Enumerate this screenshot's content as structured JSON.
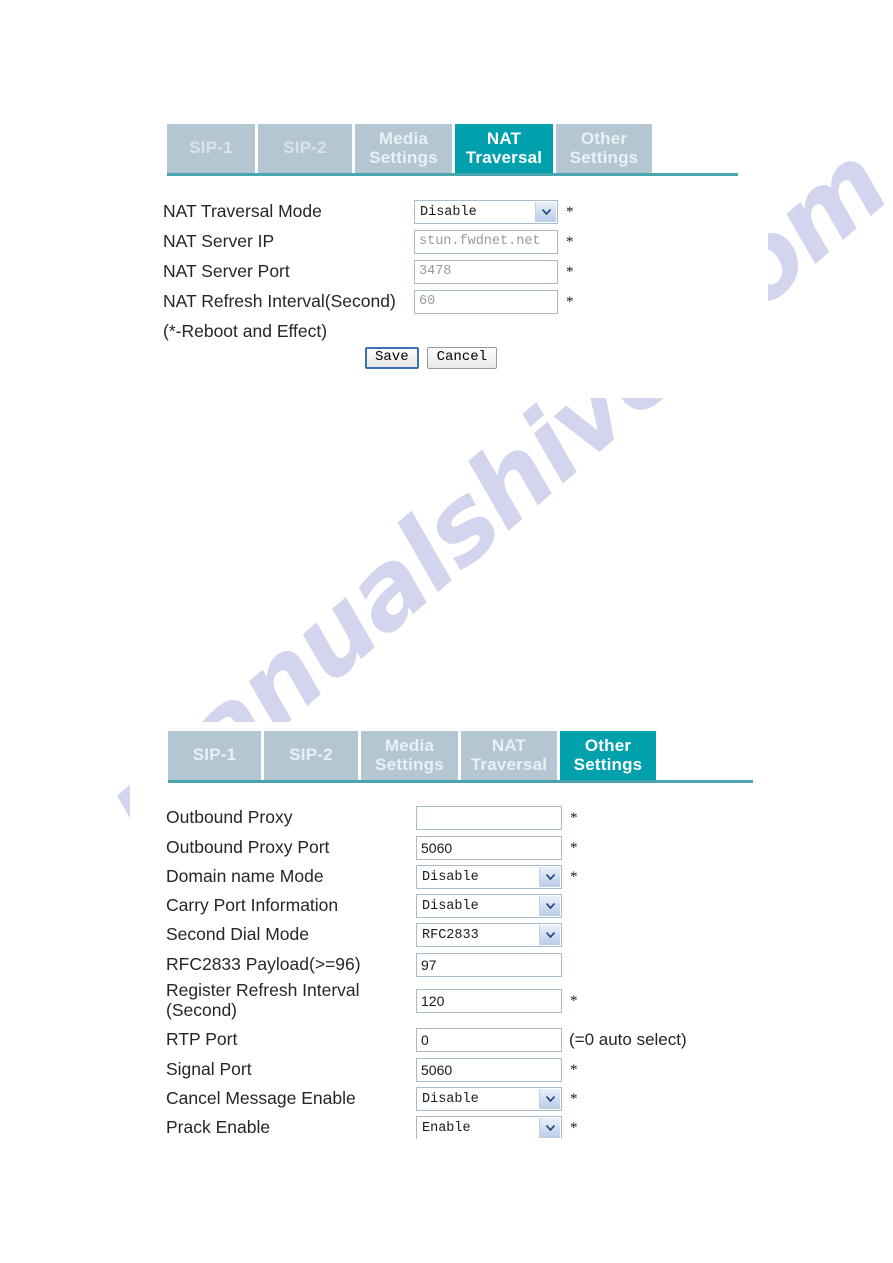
{
  "watermark": {
    "text": "manualshive.com"
  },
  "panels": {
    "nat": {
      "tabs": [
        {
          "name": "sip-1",
          "line1": "SIP-1",
          "line2": ""
        },
        {
          "name": "sip-2",
          "line1": "SIP-2",
          "line2": ""
        },
        {
          "name": "media-settings",
          "line1": "Media",
          "line2": "Settings"
        },
        {
          "name": "nat-traversal",
          "line1": "NAT",
          "line2": "Traversal"
        },
        {
          "name": "other-settings",
          "line1": "Other",
          "line2": "Settings"
        }
      ],
      "active_tab": "NAT Traversal",
      "fields": [
        {
          "label": "NAT Traversal Mode",
          "type": "select",
          "value": "Disable",
          "required": "*",
          "disabled": false
        },
        {
          "label": "NAT Server IP",
          "type": "text",
          "value": "stun.fwdnet.net",
          "required": "*",
          "disabled": true
        },
        {
          "label": "NAT Server Port",
          "type": "text",
          "value": "3478",
          "required": "*",
          "disabled": true
        },
        {
          "label": "NAT Refresh Interval(Second)",
          "type": "text",
          "value": "60",
          "required": "*",
          "disabled": true
        }
      ],
      "note": "(*-Reboot and Effect)",
      "buttons": {
        "save": "Save",
        "cancel": "Cancel"
      }
    },
    "other": {
      "tabs": [
        {
          "name": "sip-1",
          "line1": "SIP-1",
          "line2": ""
        },
        {
          "name": "sip-2",
          "line1": "SIP-2",
          "line2": ""
        },
        {
          "name": "media-settings",
          "line1": "Media",
          "line2": "Settings"
        },
        {
          "name": "nat-traversal",
          "line1": "NAT",
          "line2": "Traversal"
        },
        {
          "name": "other-settings",
          "line1": "Other",
          "line2": "Settings"
        }
      ],
      "active_tab": "Other Settings",
      "fields": [
        {
          "label": "Outbound Proxy",
          "type": "text",
          "value": "",
          "required": "*",
          "hint": ""
        },
        {
          "label": "Outbound Proxy Port",
          "type": "text",
          "value": "5060",
          "required": "*",
          "hint": ""
        },
        {
          "label": "Domain name Mode",
          "type": "select",
          "value": "Disable",
          "required": "*",
          "hint": ""
        },
        {
          "label": "Carry Port Information",
          "type": "select",
          "value": "Disable",
          "required": "",
          "hint": ""
        },
        {
          "label": "Second Dial Mode",
          "type": "select",
          "value": "RFC2833",
          "required": "",
          "hint": ""
        },
        {
          "label": "RFC2833 Payload(>=96)",
          "type": "text",
          "value": "97",
          "required": "",
          "hint": ""
        },
        {
          "label": "Register Refresh Interval\n(Second)",
          "type": "text",
          "value": "120",
          "required": "*",
          "hint": ""
        },
        {
          "label": "RTP Port",
          "type": "text",
          "value": "0",
          "required": "",
          "hint": "(=0 auto select)"
        },
        {
          "label": "Signal Port",
          "type": "text",
          "value": "5060",
          "required": "*",
          "hint": ""
        },
        {
          "label": "Cancel Message Enable",
          "type": "select",
          "value": "Disable",
          "required": "*",
          "hint": ""
        },
        {
          "label": "Prack Enable",
          "type": "select",
          "value": "Enable",
          "required": "*",
          "hint": ""
        }
      ]
    }
  },
  "colors": {
    "tab_active": "#00a0ad",
    "tab_inactive": "#b3c6d1",
    "rule": "#4aa5ae",
    "watermark": "#b9bbe4"
  }
}
